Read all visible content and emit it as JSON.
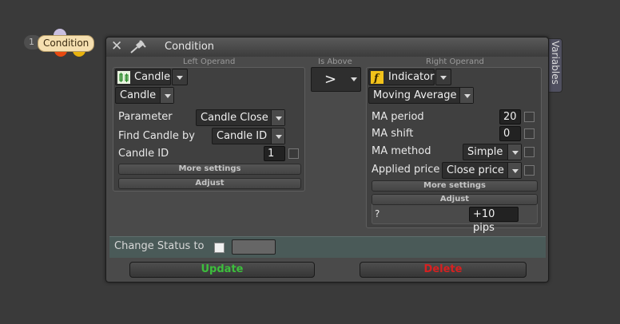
{
  "node": {
    "number": "1",
    "label": "Condition"
  },
  "window": {
    "title": "Condition",
    "variables_tab": "Variables"
  },
  "left": {
    "header": "Left Operand",
    "type_label": "Candle",
    "sub_label": "Candle",
    "parameter_label": "Parameter",
    "parameter_value": "Candle Close",
    "find_label": "Find Candle by",
    "find_value": "Candle ID",
    "id_label": "Candle ID",
    "id_value": "1",
    "more_settings": "More settings",
    "adjust": "Adjust"
  },
  "operator": {
    "header": "Is Above",
    "value": ">"
  },
  "right": {
    "header": "Right Operand",
    "type_label": "Indicator",
    "indicator_value": "Moving Average",
    "ma_period_label": "MA period",
    "ma_period_value": "20",
    "ma_shift_label": "MA shift",
    "ma_shift_value": "0",
    "ma_method_label": "MA method",
    "ma_method_value": "Simple",
    "applied_label": "Applied price",
    "applied_value": "Close price",
    "more_settings": "More settings",
    "adjust": "Adjust",
    "adjust_q": "?",
    "adjust_value": "+10 pips"
  },
  "status": {
    "label": "Change Status to"
  },
  "buttons": {
    "update": "Update",
    "delete": "Delete"
  },
  "colors": {
    "update": "#3cbf3c",
    "delete": "#d82020",
    "node_label_bg": "#f5dfb0"
  },
  "icons": {
    "close": "close-icon",
    "pin": "pin-icon",
    "candle": "candle-icon",
    "function": "function-icon"
  }
}
